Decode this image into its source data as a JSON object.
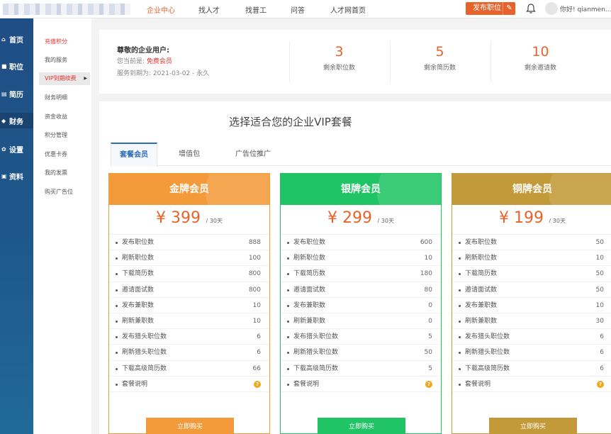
{
  "header": {
    "nav": [
      "企业中心",
      "找人才",
      "找普工",
      "问答",
      "人才网首页"
    ],
    "active_nav": 0,
    "publish_label": "发布职位",
    "greeting": "你好! qianmen..."
  },
  "sidebar": {
    "items": [
      {
        "label": "首页",
        "icon": "home-icon"
      },
      {
        "label": "职位",
        "icon": "briefcase-icon"
      },
      {
        "label": "简历",
        "icon": "resume-icon"
      },
      {
        "label": "财务",
        "icon": "finance-icon"
      },
      {
        "label": "设置",
        "icon": "gear-icon"
      },
      {
        "label": "资料",
        "icon": "profile-icon"
      }
    ],
    "active": 3
  },
  "submenu": {
    "items": [
      "充值积分",
      "我的服务",
      "VIP到期续费",
      "财务明细",
      "资金收益",
      "积分管理",
      "优惠卡券",
      "我的发票",
      "购买广告位"
    ]
  },
  "user": {
    "title": "尊敬的企业用户:",
    "level_label": "您当前是:",
    "level_value": "免费会员",
    "expiry_label": "服务到期为:",
    "expiry_value": "2021-03-02 - 永久"
  },
  "stats": [
    {
      "num": "3",
      "label": "剩余职位数"
    },
    {
      "num": "5",
      "label": "剩余简历数"
    },
    {
      "num": "10",
      "label": "剩余邀请数"
    }
  ],
  "main": {
    "title": "选择适合您的企业VIP套餐",
    "tabs": [
      "套餐会员",
      "增值包",
      "广告位推广"
    ],
    "active_tab": 0
  },
  "plans": [
    {
      "name": "金牌会员",
      "price": "¥ 399",
      "period": "/ 30天",
      "color": "#f39a3a",
      "buy": "立即购买",
      "features": [
        {
          "name": "发布职位数",
          "value": "888"
        },
        {
          "name": "刷新职位数",
          "value": "100"
        },
        {
          "name": "下载简历数",
          "value": "800"
        },
        {
          "name": "邀请面试数",
          "value": "800"
        },
        {
          "name": "发布兼职数",
          "value": "10"
        },
        {
          "name": "刷新兼职数",
          "value": "10"
        },
        {
          "name": "发布猎头职位数",
          "value": "6"
        },
        {
          "name": "刷新猎头职位数",
          "value": "6"
        },
        {
          "name": "下载高级简历数",
          "value": "66"
        }
      ],
      "note": "套餐说明"
    },
    {
      "name": "银牌会员",
      "price": "¥ 299",
      "period": "/ 30天",
      "color": "#21c465",
      "buy": "立即购买",
      "features": [
        {
          "name": "发布职位数",
          "value": "600"
        },
        {
          "name": "刷新职位数",
          "value": "10"
        },
        {
          "name": "下载简历数",
          "value": "180"
        },
        {
          "name": "邀请面试数",
          "value": "80"
        },
        {
          "name": "发布兼职数",
          "value": "0"
        },
        {
          "name": "刷新兼职数",
          "value": "0"
        },
        {
          "name": "发布猎头职位数",
          "value": "5"
        },
        {
          "name": "刷新猎头职位数",
          "value": "50"
        },
        {
          "name": "下载高级简历数",
          "value": "5"
        }
      ],
      "note": "套餐说明"
    },
    {
      "name": "铜牌会员",
      "price": "¥ 199",
      "period": "/ 30天",
      "color": "#c39a3a",
      "buy": "立即购买",
      "features": [
        {
          "name": "发布职位数",
          "value": "50"
        },
        {
          "name": "刷新职位数",
          "value": "10"
        },
        {
          "name": "下载简历数",
          "value": "50"
        },
        {
          "name": "邀请面试数",
          "value": "50"
        },
        {
          "name": "发布兼职数",
          "value": "10"
        },
        {
          "name": "刷新兼职数",
          "value": "30"
        },
        {
          "name": "发布猎头职位数",
          "value": "6"
        },
        {
          "name": "刷新猎头职位数",
          "value": "6"
        },
        {
          "name": "下载高级简历数",
          "value": "6"
        }
      ],
      "note": "套餐说明"
    }
  ]
}
